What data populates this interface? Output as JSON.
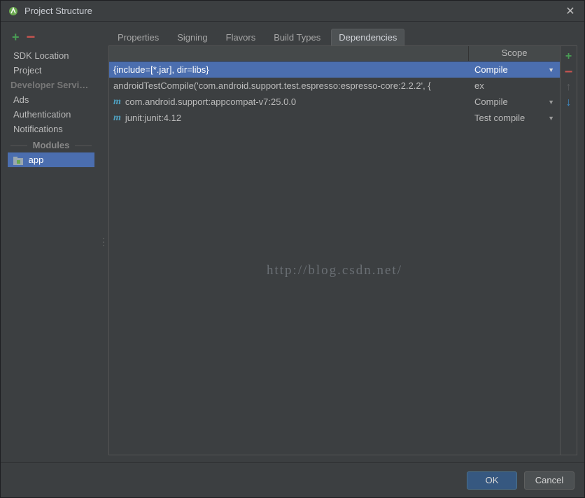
{
  "window": {
    "title": "Project Structure"
  },
  "sidebar": {
    "items": [
      {
        "label": "SDK Location",
        "type": "item"
      },
      {
        "label": "Project",
        "type": "item"
      },
      {
        "label": "Developer Servic...",
        "type": "header"
      },
      {
        "label": "Ads",
        "type": "item"
      },
      {
        "label": "Authentication",
        "type": "item"
      },
      {
        "label": "Notifications",
        "type": "item"
      }
    ],
    "modules_label": "Modules",
    "module": "app"
  },
  "tabs": [
    {
      "label": "Properties",
      "active": false
    },
    {
      "label": "Signing",
      "active": false
    },
    {
      "label": "Flavors",
      "active": false
    },
    {
      "label": "Build Types",
      "active": false
    },
    {
      "label": "Dependencies",
      "active": true
    }
  ],
  "table": {
    "scope_header": "Scope",
    "rows": [
      {
        "name": "{include=[*.jar], dir=libs}",
        "scope": "Compile",
        "icon": "",
        "selected": true
      },
      {
        "name": "androidTestCompile('com.android.support.test.espresso:espresso-core:2.2.2', {",
        "scope": "ex",
        "icon": "",
        "selected": false
      },
      {
        "name": "com.android.support:appcompat-v7:25.0.0",
        "scope": "Compile",
        "icon": "m",
        "selected": false
      },
      {
        "name": "junit:junit:4.12",
        "scope": "Test compile",
        "icon": "m",
        "selected": false
      }
    ]
  },
  "watermark": "http://blog.csdn.net/",
  "buttons": {
    "ok": "OK",
    "cancel": "Cancel"
  }
}
